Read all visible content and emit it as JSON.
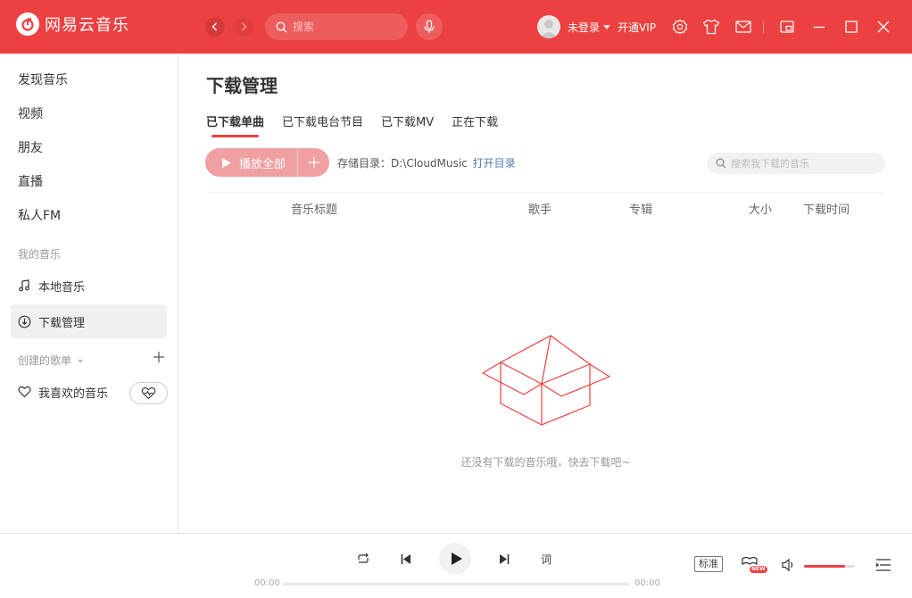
{
  "app": {
    "name": "网易云音乐"
  },
  "search": {
    "placeholder": "搜索"
  },
  "user": {
    "login_label": "未登录",
    "vip_label": "开通VIP"
  },
  "sidebar": {
    "items": [
      {
        "label": "发现音乐"
      },
      {
        "label": "视频"
      },
      {
        "label": "朋友"
      },
      {
        "label": "直播"
      },
      {
        "label": "私人FM"
      }
    ],
    "my_music_title": "我的音乐",
    "my_music": [
      {
        "label": "本地音乐"
      },
      {
        "label": "下载管理"
      }
    ],
    "created_title": "创建的歌单",
    "playlists": [
      {
        "label": "我喜欢的音乐"
      }
    ]
  },
  "main": {
    "title": "下载管理",
    "tabs": [
      {
        "label": "已下载单曲",
        "active": true
      },
      {
        "label": "已下载电台节目"
      },
      {
        "label": "已下载MV"
      },
      {
        "label": "正在下载"
      }
    ],
    "play_all_label": "播放全部",
    "storage_label": "存储目录：",
    "storage_path": "D:\\CloudMusic",
    "open_dir_label": "打开目录",
    "search_placeholder": "搜索我下载的音乐",
    "columns": [
      "音乐标题",
      "歌手",
      "专辑",
      "大小",
      "下载时间"
    ],
    "empty_text": "还没有下载的音乐哦，快去下载吧~"
  },
  "player": {
    "current_time": "00:00",
    "total_time": "00:00",
    "lyric_label": "词",
    "quality_label": "标准",
    "new_badge": "NEW",
    "volume_fraction": 0.8
  },
  "colors": {
    "accent": "#ec4141",
    "link": "#507daf"
  }
}
